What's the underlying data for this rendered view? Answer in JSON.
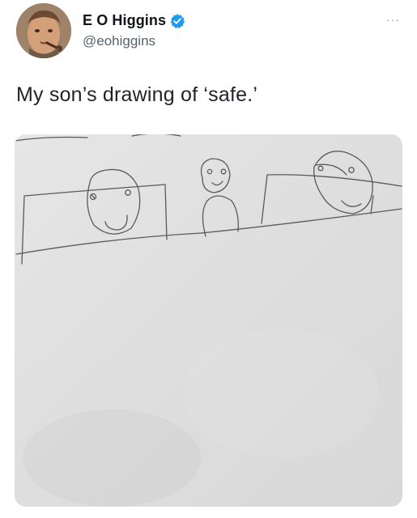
{
  "tweet": {
    "author": {
      "display_name": "E O Higgins",
      "handle": "@eohiggins",
      "verified": true,
      "verified_color": "#1d9bf0"
    },
    "more_label": "···",
    "text": "My son’s drawing of ‘safe.’",
    "media": {
      "kind": "pencil drawing on paper",
      "paper_color": "#e0e0e0",
      "pencil_color": "#5a5a5a"
    }
  }
}
